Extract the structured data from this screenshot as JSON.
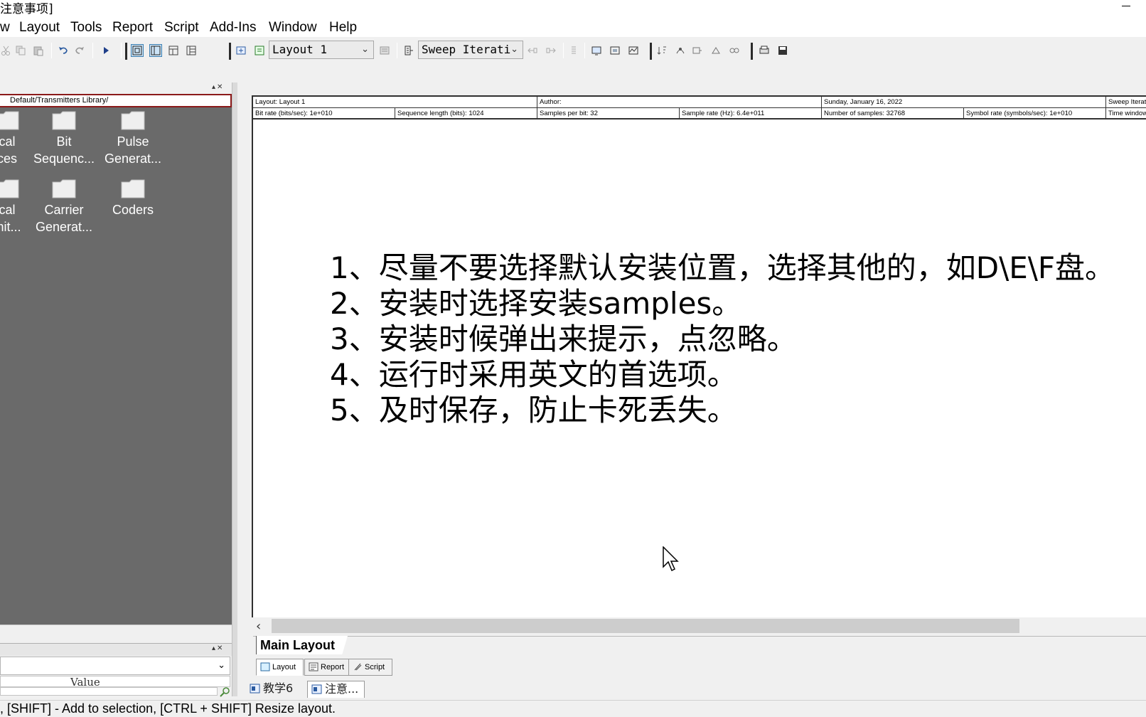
{
  "window": {
    "title": "注意事项]"
  },
  "menu": {
    "items": [
      "w",
      "Layout",
      "Tools",
      "Report",
      "Script",
      "Add-Ins",
      "Window",
      "Help"
    ]
  },
  "toolbar": {
    "layout_combo": "Layout 1",
    "sweep_combo": "Sweep Iterati"
  },
  "library": {
    "path": "Default/Transmitters Library/",
    "folders": [
      {
        "label_line1": "cal",
        "label_line2": "ces"
      },
      {
        "label_line1": "Bit",
        "label_line2": "Sequenc..."
      },
      {
        "label_line1": "Pulse",
        "label_line2": "Generat..."
      },
      {
        "label_line1": "cal",
        "label_line2": "mit..."
      },
      {
        "label_line1": "Carrier",
        "label_line2": "Generat..."
      },
      {
        "label_line1": "Coders",
        "label_line2": ""
      }
    ]
  },
  "properties": {
    "column_header": "Value"
  },
  "layout_info": {
    "row1": [
      "Layout: Layout 1",
      "Author:",
      "Sunday, January 16, 2022",
      "Sweep Iterat"
    ],
    "row2": [
      "Bit rate (bits/sec):  1e+010",
      "Sequence length (bits):  1024",
      "Samples per bit:  32",
      "Sample rate (Hz):  6.4e+011",
      "Number of samples:  32768",
      "Symbol rate (symbols/sec):  1e+010",
      "Time window"
    ]
  },
  "notes": [
    "1、尽量不要选择默认安装位置，选择其他的，如D\\E\\F盘。",
    "2、安装时选择安装samples。",
    "3、安装时候弹出来提示，点忽略。",
    "4、运行时采用英文的首选项。",
    "5、及时保存，防止卡死丢失。"
  ],
  "sheet_tab": "Main Layout",
  "view_tabs": [
    "Layout",
    "Report",
    "Script"
  ],
  "window_tabs": [
    "教学6",
    "注意..."
  ],
  "status": {
    "text": ", [SHIFT] - Add to selection, [CTRL + SHIFT] Resize layout."
  },
  "colors": {
    "library_background": "#6a6a6a",
    "library_header_border": "#8b1a1a",
    "canvas": "#ffffff"
  }
}
